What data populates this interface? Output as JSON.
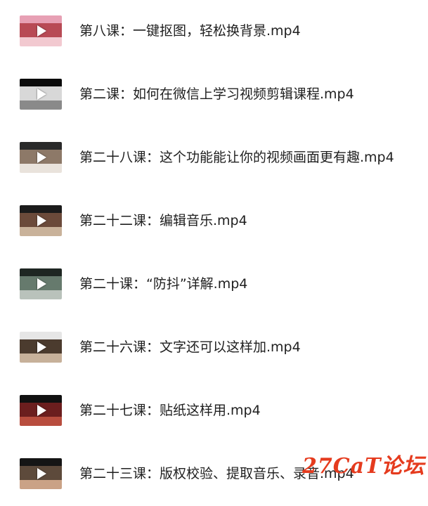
{
  "files": [
    {
      "name": "第八课：一键抠图，轻松换背景.mp4",
      "thumb_colors": [
        "#e7a0b4",
        "#b84a55",
        "#f2c9d0"
      ]
    },
    {
      "name": "第二课：如何在微信上学习视频剪辑课程.mp4",
      "thumb_colors": [
        "#0b0b0b",
        "#d8d8d8",
        "#8a8a8a"
      ]
    },
    {
      "name": "第二十八课：这个功能能让你的视频画面更有趣.mp4",
      "thumb_colors": [
        "#2a2a2a",
        "#8d7968",
        "#e9e3dc"
      ]
    },
    {
      "name": "第二十二课：编辑音乐.mp4",
      "thumb_colors": [
        "#1b1b1b",
        "#6b4a3a",
        "#c9b29a"
      ]
    },
    {
      "name": "第二十课：“防抖”详解.mp4",
      "thumb_colors": [
        "#1e2622",
        "#667a6d",
        "#b9c2bb"
      ]
    },
    {
      "name": "第二十六课：文字还可以这样加.mp4",
      "thumb_colors": [
        "#e6e6e6",
        "#4b3b2e",
        "#c7b19a"
      ]
    },
    {
      "name": "第二十七课：贴纸这样用.mp4",
      "thumb_colors": [
        "#111111",
        "#6b1e1e",
        "#b84d3e"
      ]
    },
    {
      "name": "第二十三课：版权校验、提取音乐、录音.mp4",
      "thumb_colors": [
        "#151515",
        "#5d4a3b",
        "#caa286"
      ]
    }
  ],
  "watermark": {
    "text": "27CaT论坛",
    "color": "#e53b1e"
  }
}
